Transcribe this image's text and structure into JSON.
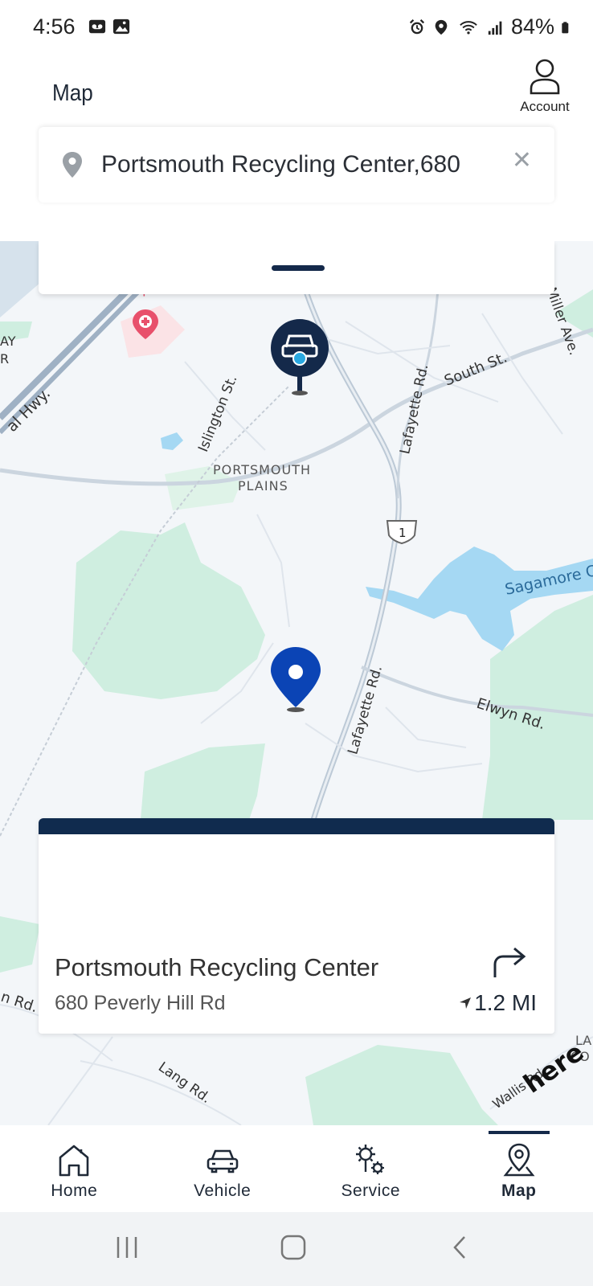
{
  "status_bar": {
    "time": "4:56",
    "battery": "84%"
  },
  "header": {
    "title": "Map",
    "account_label": "Account"
  },
  "search": {
    "value": "Portsmouth Recycling Center,680"
  },
  "map": {
    "labels": {
      "hospital": "Hospital",
      "ay": "AY",
      "r": "R",
      "hwy": "al Hwy.",
      "islington": "Islington St.",
      "lafayette_top": "Lafayette Rd.",
      "south": "South St.",
      "miller": "Miller Ave.",
      "plains_1": "PORTSMOUTH",
      "plains_2": "PLAINS",
      "route": "1",
      "sagamore": "Sagamore C",
      "lafayette_bottom": "Lafayette Rd.",
      "elwyn": "Elwyn Rd.",
      "n_rd": "n Rd.",
      "lang": "Lang Rd.",
      "wallis": "Wallis Rd.",
      "la": "LA",
      "co": "CO",
      "here_logo": "here"
    },
    "colors": {
      "water": "#a5d8f3",
      "park": "#cfeee0",
      "road": "#c3ceda",
      "pin": "#0b44b5",
      "vehicle_pin": "#14294a"
    }
  },
  "place": {
    "name": "Portsmouth Recycling Center",
    "address": "680 Peverly Hill Rd",
    "distance": "1.2 MI"
  },
  "nav": {
    "items": [
      {
        "label": "Home",
        "icon": "home-icon"
      },
      {
        "label": "Vehicle",
        "icon": "car-icon"
      },
      {
        "label": "Service",
        "icon": "gears-icon"
      },
      {
        "label": "Map",
        "icon": "map-pin-icon"
      }
    ],
    "active": "Map"
  }
}
